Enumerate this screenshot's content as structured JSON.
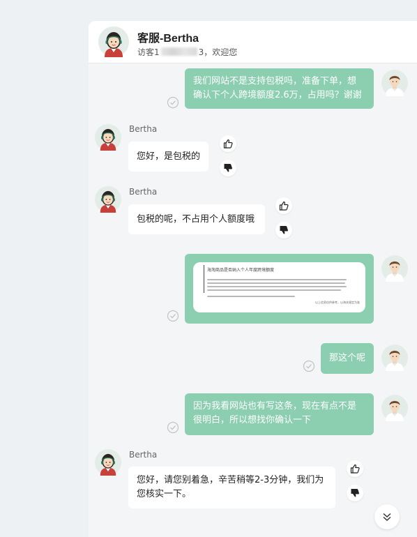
{
  "header": {
    "title": "客服-Bertha",
    "subtitle_prefix": "访客1",
    "subtitle_suffix": "3，欢迎您"
  },
  "messages": {
    "m1": {
      "lines": [
        "我们网站不是支持包税吗，准备下单，想",
        "确认下个人跨境额度2.6万，占用吗？谢谢"
      ]
    },
    "m2": {
      "name": "Bertha",
      "text": "您好，是包税的"
    },
    "m3": {
      "name": "Bertha",
      "text": "包税的呢，不占用个人额度哦"
    },
    "m4": {
      "image_title": "海淘商品是否纳入个人年度跨境额度",
      "image_footer": "以上信息仅供参考，以海关规定为准"
    },
    "m5": {
      "text": "那这个呢"
    },
    "m6": {
      "lines": [
        "因为我看网站也有写这条，现在有点不是",
        "很明白，所以想找你确认一下"
      ]
    },
    "m7": {
      "name": "Bertha",
      "lines": [
        "您好，请您别着急，辛苦稍等2-3分钟，我们为",
        "您核实一下。"
      ]
    }
  },
  "colors": {
    "page_bg": "#edf1f4",
    "chat_bg": "#f4f5f6",
    "outgoing_bubble": "#8ccfb0",
    "incoming_bubble": "#ffffff"
  },
  "icons": {
    "agent_avatar": "agent-avatar-icon",
    "visitor_avatar": "visitor-avatar-icon",
    "read_receipt": "check-circle-icon",
    "like": "thumbs-up-icon",
    "dislike": "thumbs-down-icon",
    "scroll": "chevron-double-down-icon"
  }
}
